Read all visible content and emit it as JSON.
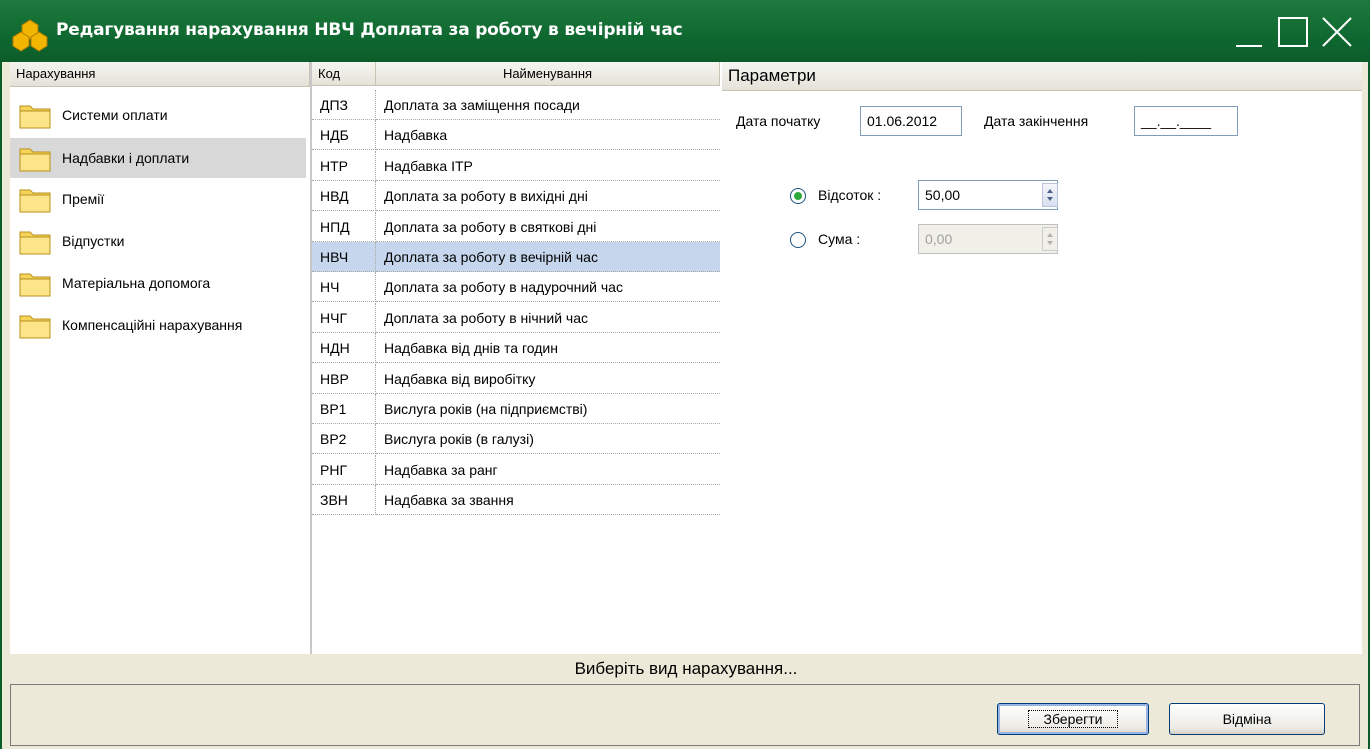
{
  "window": {
    "title": "Редагування нарахування НВЧ Доплата за роботу в вечірній час"
  },
  "left": {
    "header": "Нарахування",
    "items": [
      {
        "label": "Системи оплати"
      },
      {
        "label": "Надбавки і доплати"
      },
      {
        "label": "Премії"
      },
      {
        "label": "Відпустки"
      },
      {
        "label": "Матеріальна допомога"
      },
      {
        "label": "Компенсаційні нарахування"
      }
    ],
    "selected": "Надбавки і доплати"
  },
  "grid": {
    "col_code": "Код",
    "col_name": "Найменування",
    "rows": [
      {
        "code": "ДПЗ",
        "name": "Доплата за заміщення посади"
      },
      {
        "code": "НДБ",
        "name": "Надбавка"
      },
      {
        "code": "НТР",
        "name": "Надбавка ІТР"
      },
      {
        "code": "НВД",
        "name": "Доплата за роботу в вихідні дні"
      },
      {
        "code": "НПД",
        "name": "Доплата за роботу в святкові дні"
      },
      {
        "code": "НВЧ",
        "name": "Доплата за роботу в вечірній час"
      },
      {
        "code": "НЧ",
        "name": "Доплата за роботу в надурочний час"
      },
      {
        "code": "НЧГ",
        "name": "Доплата за роботу в нічний час"
      },
      {
        "code": "НДН",
        "name": "Надбавка від днів та годин"
      },
      {
        "code": "НВР",
        "name": "Надбавка від виробітку"
      },
      {
        "code": "ВР1",
        "name": "Вислуга років (на підприємстві)"
      },
      {
        "code": "ВР2",
        "name": "Вислуга років (в галузі)"
      },
      {
        "code": "РНГ",
        "name": "Надбавка за ранг"
      },
      {
        "code": "ЗВН",
        "name": "Надбавка за звання"
      }
    ],
    "selected_code": "НВЧ"
  },
  "params": {
    "header": "Параметри",
    "start_label": "Дата початку",
    "start_value": "01.06.2012",
    "end_label": "Дата закінчення",
    "end_value": "__.__.____",
    "percent_label": "Відсоток :",
    "percent_value": "50,00",
    "sum_label": "Сума :",
    "sum_value": "0,00",
    "selected_mode": "percent"
  },
  "status": {
    "text": "Виберіть вид нарахування..."
  },
  "buttons": {
    "save": "Зберегти",
    "cancel": "Відміна"
  },
  "colors": {
    "titlebar": "#0f6830",
    "selection_row": "#c6d6ec",
    "selection_left": "#d8d8d8"
  }
}
